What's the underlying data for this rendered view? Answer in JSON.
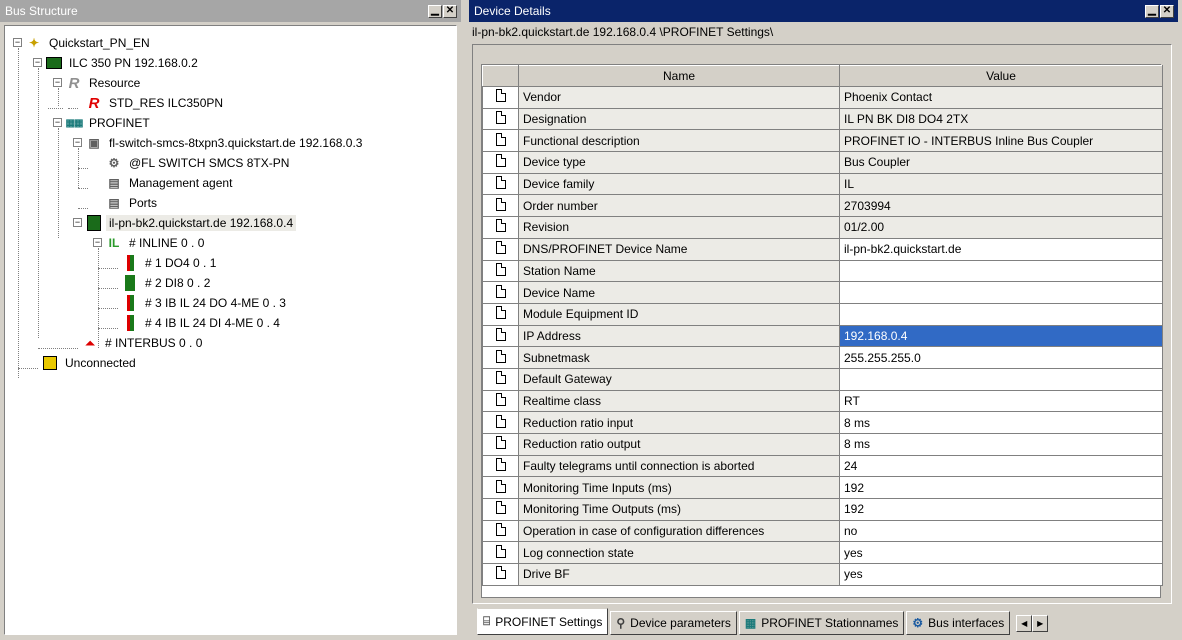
{
  "left_panel": {
    "title": "Bus Structure",
    "tree": {
      "root": "Quickstart_PN_EN",
      "controller": "ILC 350 PN 192.168.0.2",
      "resource": "Resource",
      "std_res": "STD_RES ILC350PN",
      "profinet": "PROFINET",
      "switch": "fl-switch-smcs-8txpn3.quickstart.de 192.168.0.3",
      "switch_child": "@FL SWITCH SMCS 8TX-PN",
      "management": "Management agent",
      "ports": "Ports",
      "bk2": "il-pn-bk2.quickstart.de 192.168.0.4",
      "inline": "# INLINE 0 . 0",
      "do4": "# 1 DO4 0 . 1",
      "di8": "# 2 DI8 0 . 2",
      "ib_do": "# 3 IB IL 24 DO 4-ME 0 . 3",
      "ib_di": "# 4 IB IL 24 DI 4-ME 0 . 4",
      "interbus": "# INTERBUS 0 . 0",
      "unconnected": "Unconnected"
    }
  },
  "right_panel": {
    "title": "Device Details",
    "path": "il-pn-bk2.quickstart.de 192.168.0.4 \\PROFINET Settings\\",
    "columns": {
      "name": "Name",
      "value": "Value"
    },
    "rows": [
      {
        "name": "Vendor",
        "value": "Phoenix Contact"
      },
      {
        "name": "Designation",
        "value": "IL PN BK DI8 DO4 2TX"
      },
      {
        "name": "Functional description",
        "value": "PROFINET IO - INTERBUS Inline Bus Coupler"
      },
      {
        "name": "Device type",
        "value": "Bus Coupler"
      },
      {
        "name": "Device family",
        "value": "IL"
      },
      {
        "name": "Order number",
        "value": "2703994"
      },
      {
        "name": "Revision",
        "value": "01/2.00"
      },
      {
        "name": "DNS/PROFINET Device Name",
        "value": "il-pn-bk2.quickstart.de",
        "editable": true
      },
      {
        "name": "Station Name",
        "value": "",
        "editable": true
      },
      {
        "name": "Device Name",
        "value": "",
        "editable": true
      },
      {
        "name": "Module Equipment ID",
        "value": "",
        "editable": true
      },
      {
        "name": "IP Address",
        "value": "192.168.0.4",
        "selected": true
      },
      {
        "name": "Subnetmask",
        "value": "255.255.255.0",
        "editable": true
      },
      {
        "name": "Default Gateway",
        "value": "",
        "editable": true
      },
      {
        "name": "Realtime class",
        "value": "RT",
        "editable": true
      },
      {
        "name": "Reduction ratio input",
        "value": "8 ms",
        "editable": true
      },
      {
        "name": "Reduction ratio output",
        "value": "8 ms",
        "editable": true
      },
      {
        "name": "Faulty telegrams until connection is aborted",
        "value": "24",
        "editable": true
      },
      {
        "name": "Monitoring Time Inputs (ms)",
        "value": "192",
        "editable": true
      },
      {
        "name": "Monitoring Time Outputs (ms)",
        "value": "192",
        "editable": true
      },
      {
        "name": "Operation in case of configuration differences",
        "value": "no",
        "editable": true
      },
      {
        "name": "Log connection state",
        "value": "yes",
        "editable": true
      },
      {
        "name": "Drive BF",
        "value": "yes",
        "editable": true
      }
    ],
    "tabs": [
      {
        "label": "PROFINET Settings",
        "icon": "network-icon",
        "active": true
      },
      {
        "label": "Device parameters",
        "icon": "wrench-icon"
      },
      {
        "label": "PROFINET Stationnames",
        "icon": "profinet-icon"
      },
      {
        "label": "Bus interfaces",
        "icon": "bus-interface-icon"
      }
    ]
  },
  "colors": {
    "active_title": "#0a246a",
    "inactive_title": "#a6a6a6",
    "selection": "#316ac5",
    "readonly_cell": "#ecebe6"
  }
}
